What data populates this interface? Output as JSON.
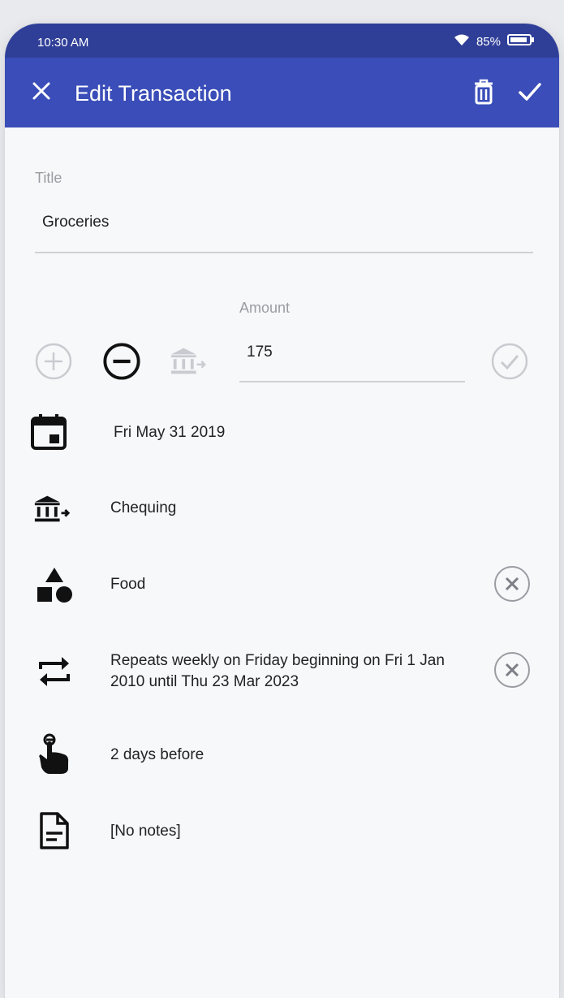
{
  "status_bar": {
    "time": "10:30 AM",
    "battery": "85%"
  },
  "app_bar": {
    "title": "Edit Transaction"
  },
  "title_field": {
    "label": "Title",
    "value": "Groceries"
  },
  "amount_field": {
    "label": "Amount",
    "value": "175"
  },
  "rows": {
    "date": "Fri May 31 2019",
    "account": "Chequing",
    "category": "Food",
    "repeat": "Repeats weekly on Friday beginning on Fri 1 Jan 2010 until Thu 23 Mar 2023",
    "reminder": "2 days before",
    "notes": "[No notes]"
  },
  "icons": {
    "close": "close-icon",
    "delete": "trash-icon",
    "save": "check-icon",
    "income": "plus-circle-icon",
    "expense": "minus-circle-icon",
    "transfer": "bank-transfer-icon",
    "confirm": "check-circle-icon",
    "date": "calendar-icon",
    "account": "bank-icon",
    "category": "shapes-icon",
    "repeat": "repeat-icon",
    "reminder": "touch-reminder-icon",
    "notes": "document-icon",
    "clear": "close-circle-icon"
  },
  "colors": {
    "app_bar": "#3a4db8",
    "status_bar": "#2f3f98",
    "background": "#f7f8fa"
  }
}
